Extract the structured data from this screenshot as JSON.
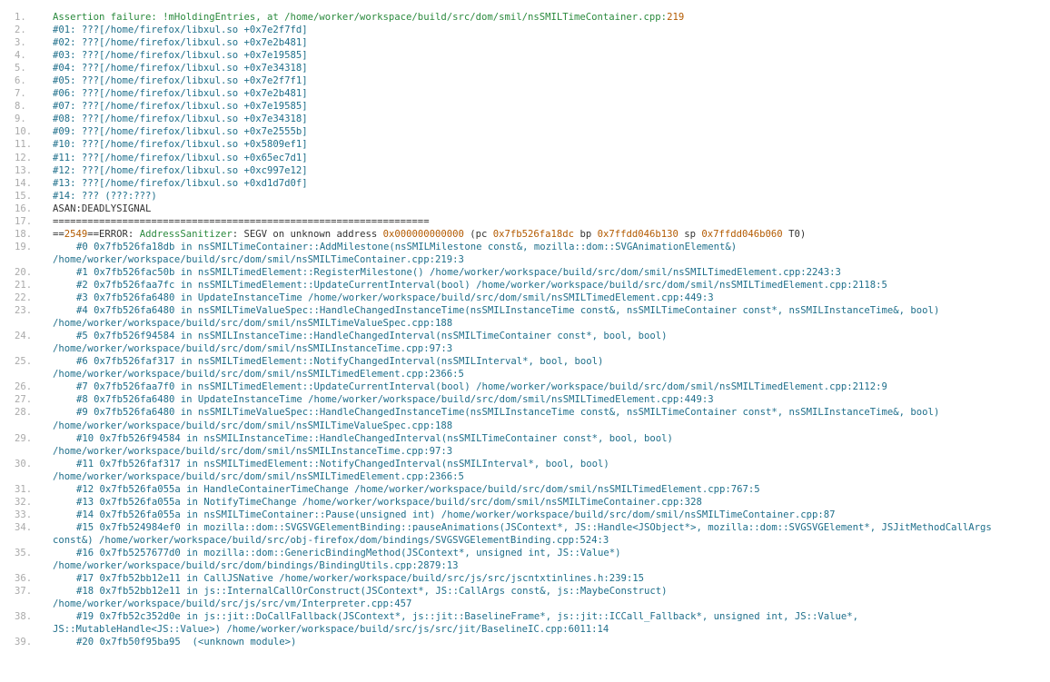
{
  "lines": [
    {
      "n": "1.",
      "segs": [
        {
          "t": "Assertion failure: !mHoldingEntries, at /home/worker/workspace/build/src/dom/smil/nsSMILTimeContainer.cpp:",
          "c": "green"
        },
        {
          "t": "219",
          "c": "orange"
        }
      ]
    },
    {
      "n": "2.",
      "segs": [
        {
          "t": "#01: ???[/home/firefox/libxul.so +0x7e2f7fd]",
          "c": "teal"
        }
      ]
    },
    {
      "n": "3.",
      "segs": [
        {
          "t": "#02: ???[/home/firefox/libxul.so +0x7e2b481]",
          "c": "teal"
        }
      ]
    },
    {
      "n": "4.",
      "segs": [
        {
          "t": "#03: ???[/home/firefox/libxul.so +0x7e19585]",
          "c": "teal"
        }
      ]
    },
    {
      "n": "5.",
      "segs": [
        {
          "t": "#04: ???[/home/firefox/libxul.so +0x7e34318]",
          "c": "teal"
        }
      ]
    },
    {
      "n": "6.",
      "segs": [
        {
          "t": "#05: ???[/home/firefox/libxul.so +0x7e2f7f1]",
          "c": "teal"
        }
      ]
    },
    {
      "n": "7.",
      "segs": [
        {
          "t": "#06: ???[/home/firefox/libxul.so +0x7e2b481]",
          "c": "teal"
        }
      ]
    },
    {
      "n": "8.",
      "segs": [
        {
          "t": "#07: ???[/home/firefox/libxul.so +0x7e19585]",
          "c": "teal"
        }
      ]
    },
    {
      "n": "9.",
      "segs": [
        {
          "t": "#08: ???[/home/firefox/libxul.so +0x7e34318]",
          "c": "teal"
        }
      ]
    },
    {
      "n": "10.",
      "segs": [
        {
          "t": "#09: ???[/home/firefox/libxul.so +0x7e2555b]",
          "c": "teal"
        }
      ]
    },
    {
      "n": "11.",
      "segs": [
        {
          "t": "#10: ???[/home/firefox/libxul.so +0x5809ef1]",
          "c": "teal"
        }
      ]
    },
    {
      "n": "12.",
      "segs": [
        {
          "t": "#11: ???[/home/firefox/libxul.so +0x65ec7d1]",
          "c": "teal"
        }
      ]
    },
    {
      "n": "13.",
      "segs": [
        {
          "t": "#12: ???[/home/firefox/libxul.so +0xc997e12]",
          "c": "teal"
        }
      ]
    },
    {
      "n": "14.",
      "segs": [
        {
          "t": "#13: ???[/home/firefox/libxul.so +0xd1d7d0f]",
          "c": "teal"
        }
      ]
    },
    {
      "n": "15.",
      "segs": [
        {
          "t": "#14: ??? (???:???)",
          "c": "teal"
        }
      ]
    },
    {
      "n": "16.",
      "segs": [
        {
          "t": "ASAN:DEADLYSIGNAL",
          "c": "dark"
        }
      ]
    },
    {
      "n": "17.",
      "segs": [
        {
          "t": "=================================================================",
          "c": "dark"
        }
      ]
    },
    {
      "n": "18.",
      "segs": [
        {
          "t": "==",
          "c": "dark"
        },
        {
          "t": "2549",
          "c": "orange"
        },
        {
          "t": "==ERROR: ",
          "c": "dark"
        },
        {
          "t": "AddressSanitizer",
          "c": "green"
        },
        {
          "t": ": SEGV on unknown address ",
          "c": "dark"
        },
        {
          "t": "0x000000000000",
          "c": "orange"
        },
        {
          "t": " (pc ",
          "c": "dark"
        },
        {
          "t": "0x7fb526fa18dc",
          "c": "orange"
        },
        {
          "t": " bp ",
          "c": "dark"
        },
        {
          "t": "0x7ffdd046b130",
          "c": "orange"
        },
        {
          "t": " sp ",
          "c": "dark"
        },
        {
          "t": "0x7ffdd046b060",
          "c": "orange"
        },
        {
          "t": " T0)",
          "c": "dark"
        }
      ]
    },
    {
      "n": "19.",
      "indent": true,
      "segs": [
        {
          "t": "#0 0x7fb526fa18db in nsSMILTimeContainer::AddMilestone(nsSMILMilestone const&, mozilla::dom::SVGAnimationElement&)",
          "c": "teal"
        }
      ],
      "cont": "/home/worker/workspace/build/src/dom/smil/nsSMILTimeContainer.cpp:219:3"
    },
    {
      "n": "20.",
      "indent": true,
      "segs": [
        {
          "t": "#1 0x7fb526fac50b in nsSMILTimedElement::RegisterMilestone() /home/worker/workspace/build/src/dom/smil/nsSMILTimedElement.cpp:2243:3",
          "c": "teal"
        }
      ]
    },
    {
      "n": "21.",
      "indent": true,
      "segs": [
        {
          "t": "#2 0x7fb526faa7fc in nsSMILTimedElement::UpdateCurrentInterval(bool) /home/worker/workspace/build/src/dom/smil/nsSMILTimedElement.cpp:2118:5",
          "c": "teal"
        }
      ]
    },
    {
      "n": "22.",
      "indent": true,
      "segs": [
        {
          "t": "#3 0x7fb526fa6480 in UpdateInstanceTime /home/worker/workspace/build/src/dom/smil/nsSMILTimedElement.cpp:449:3",
          "c": "teal"
        }
      ]
    },
    {
      "n": "23.",
      "indent": true,
      "segs": [
        {
          "t": "#4 0x7fb526fa6480 in nsSMILTimeValueSpec::HandleChangedInstanceTime(nsSMILInstanceTime const&, nsSMILTimeContainer const*, nsSMILInstanceTime&, bool)",
          "c": "teal"
        }
      ],
      "cont": "/home/worker/workspace/build/src/dom/smil/nsSMILTimeValueSpec.cpp:188"
    },
    {
      "n": "24.",
      "indent": true,
      "segs": [
        {
          "t": "#5 0x7fb526f94584 in nsSMILInstanceTime::HandleChangedInterval(nsSMILTimeContainer const*, bool, bool)",
          "c": "teal"
        }
      ],
      "cont": "/home/worker/workspace/build/src/dom/smil/nsSMILInstanceTime.cpp:97:3"
    },
    {
      "n": "25.",
      "indent": true,
      "segs": [
        {
          "t": "#6 0x7fb526faf317 in nsSMILTimedElement::NotifyChangedInterval(nsSMILInterval*, bool, bool)",
          "c": "teal"
        }
      ],
      "cont": "/home/worker/workspace/build/src/dom/smil/nsSMILTimedElement.cpp:2366:5"
    },
    {
      "n": "26.",
      "indent": true,
      "segs": [
        {
          "t": "#7 0x7fb526faa7f0 in nsSMILTimedElement::UpdateCurrentInterval(bool) /home/worker/workspace/build/src/dom/smil/nsSMILTimedElement.cpp:2112:9",
          "c": "teal"
        }
      ]
    },
    {
      "n": "27.",
      "indent": true,
      "segs": [
        {
          "t": "#8 0x7fb526fa6480 in UpdateInstanceTime /home/worker/workspace/build/src/dom/smil/nsSMILTimedElement.cpp:449:3",
          "c": "teal"
        }
      ]
    },
    {
      "n": "28.",
      "indent": true,
      "segs": [
        {
          "t": "#9 0x7fb526fa6480 in nsSMILTimeValueSpec::HandleChangedInstanceTime(nsSMILInstanceTime const&, nsSMILTimeContainer const*, nsSMILInstanceTime&, bool)",
          "c": "teal"
        }
      ],
      "cont": "/home/worker/workspace/build/src/dom/smil/nsSMILTimeValueSpec.cpp:188"
    },
    {
      "n": "29.",
      "indent": true,
      "segs": [
        {
          "t": "#10 0x7fb526f94584 in nsSMILInstanceTime::HandleChangedInterval(nsSMILTimeContainer const*, bool, bool)",
          "c": "teal"
        }
      ],
      "cont": "/home/worker/workspace/build/src/dom/smil/nsSMILInstanceTime.cpp:97:3"
    },
    {
      "n": "30.",
      "indent": true,
      "segs": [
        {
          "t": "#11 0x7fb526faf317 in nsSMILTimedElement::NotifyChangedInterval(nsSMILInterval*, bool, bool)",
          "c": "teal"
        }
      ],
      "cont": "/home/worker/workspace/build/src/dom/smil/nsSMILTimedElement.cpp:2366:5"
    },
    {
      "n": "31.",
      "indent": true,
      "segs": [
        {
          "t": "#12 0x7fb526fa055a in HandleContainerTimeChange /home/worker/workspace/build/src/dom/smil/nsSMILTimedElement.cpp:767:5",
          "c": "teal"
        }
      ]
    },
    {
      "n": "32.",
      "indent": true,
      "segs": [
        {
          "t": "#13 0x7fb526fa055a in NotifyTimeChange /home/worker/workspace/build/src/dom/smil/nsSMILTimeContainer.cpp:328",
          "c": "teal"
        }
      ]
    },
    {
      "n": "33.",
      "indent": true,
      "segs": [
        {
          "t": "#14 0x7fb526fa055a in nsSMILTimeContainer::Pause(unsigned int) /home/worker/workspace/build/src/dom/smil/nsSMILTimeContainer.cpp:87",
          "c": "teal"
        }
      ]
    },
    {
      "n": "34.",
      "indent": true,
      "segs": [
        {
          "t": "#15 0x7fb524984ef0 in mozilla::dom::SVGSVGElementBinding::pauseAnimations(JSContext*, JS::Handle<JSObject*>, mozilla::dom::SVGSVGElement*, JSJitMethodCallArgs",
          "c": "teal"
        }
      ],
      "cont": "const&) /home/worker/workspace/build/src/obj-firefox/dom/bindings/SVGSVGElementBinding.cpp:524:3"
    },
    {
      "n": "35.",
      "indent": true,
      "segs": [
        {
          "t": "#16 0x7fb5257677d0 in mozilla::dom::GenericBindingMethod(JSContext*, unsigned int, JS::Value*)",
          "c": "teal"
        }
      ],
      "cont": "/home/worker/workspace/build/src/dom/bindings/BindingUtils.cpp:2879:13"
    },
    {
      "n": "36.",
      "indent": true,
      "segs": [
        {
          "t": "#17 0x7fb52bb12e11 in CallJSNative /home/worker/workspace/build/src/js/src/jscntxtinlines.h:239:15",
          "c": "teal"
        }
      ]
    },
    {
      "n": "37.",
      "indent": true,
      "segs": [
        {
          "t": "#18 0x7fb52bb12e11 in js::InternalCallOrConstruct(JSContext*, JS::CallArgs const&, js::MaybeConstruct)",
          "c": "teal"
        }
      ],
      "cont": "/home/worker/workspace/build/src/js/src/vm/Interpreter.cpp:457"
    },
    {
      "n": "38.",
      "indent": true,
      "segs": [
        {
          "t": "#19 0x7fb52c352d0e in js::jit::DoCallFallback(JSContext*, js::jit::BaselineFrame*, js::jit::ICCall_Fallback*, unsigned int, JS::Value*,",
          "c": "teal"
        }
      ],
      "cont": "JS::MutableHandle<JS::Value>) /home/worker/workspace/build/src/js/src/jit/BaselineIC.cpp:6011:14"
    },
    {
      "n": "39.",
      "indent": true,
      "segs": [
        {
          "t": "#20 0x7fb50f95ba95  (<unknown module>)",
          "c": "teal"
        }
      ]
    }
  ]
}
